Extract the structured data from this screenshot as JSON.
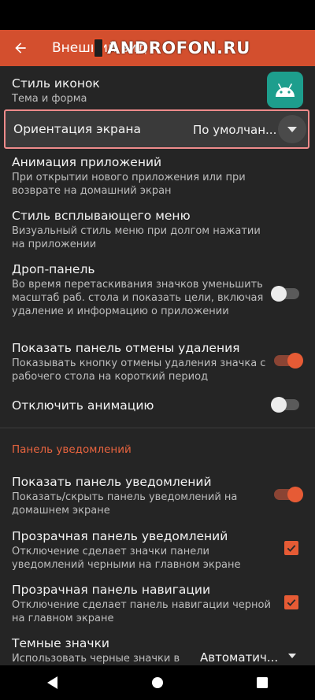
{
  "app_bar": {
    "title": "Внешний вид"
  },
  "watermark": {
    "text": "ANDROFON.RU"
  },
  "settings": [
    {
      "title": "Стиль иконок",
      "subtitle": "Тема и форма"
    },
    {
      "title": "Ориентация экрана",
      "value": "По умолчан..."
    },
    {
      "title": "Анимация приложений",
      "subtitle": "При открытии нового приложения или при возврате на домашний экран"
    },
    {
      "title": "Стиль всплывающего меню",
      "subtitle": "Визуальный стиль меню при долгом нажатии на приложении"
    },
    {
      "title": "Дроп-панель",
      "subtitle": "Во время перетаскивания значков уменьшить масштаб раб. стола и показать цели, включая удаление и информацию о приложении",
      "enabled": false
    },
    {
      "title": "Показать панель отмены удаления",
      "subtitle": "Показывать кнопку отмены удаления значка с рабочего стола на короткий период",
      "enabled": true
    },
    {
      "title": "Отключить анимацию",
      "enabled": false
    }
  ],
  "section": {
    "header": "Панель уведомлений"
  },
  "notif_settings": [
    {
      "title": "Показать панель уведомлений",
      "subtitle": "Показать/скрыть панель уведомлений на домашнем экране",
      "enabled": true
    },
    {
      "title": "Прозрачная панель уведомлений",
      "subtitle": "Отключение сделает значки панели уведомлений черными на главном экране",
      "checked": true
    },
    {
      "title": "Прозрачная панель навигации",
      "subtitle": "Отключение сделает панель навигации черной на главном экране",
      "checked": true
    },
    {
      "title": "Темные значки",
      "subtitle": "Использовать черные значки в панели уведомлений на главном экране",
      "value": "Автоматич..."
    }
  ],
  "colors": {
    "accent": "#e65b35",
    "app_bar": "#d34f2e",
    "background": "#252525",
    "icon_tile": "#1d9e8d"
  }
}
